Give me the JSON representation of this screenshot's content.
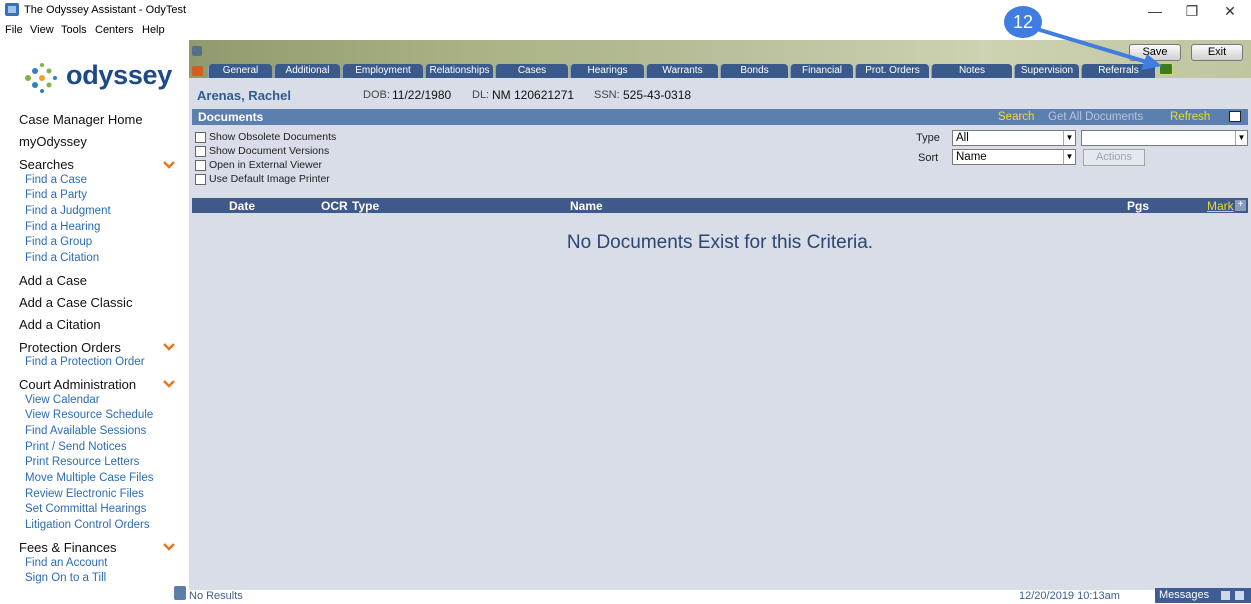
{
  "window": {
    "title": "The Odyssey Assistant - OdyTest",
    "minimize_glyph": "—",
    "restore_glyph": "❐",
    "close_glyph": "✕"
  },
  "menu": [
    "File",
    "View",
    "Tools",
    "Centers",
    "Help"
  ],
  "sidebar": {
    "logo_text": "odyssey",
    "items": [
      {
        "type": "head",
        "label": "Case Manager Home"
      },
      {
        "type": "head",
        "label": "myOdyssey"
      },
      {
        "type": "head",
        "label": "Searches",
        "chevron": true
      },
      {
        "type": "link",
        "label": "Find a Case"
      },
      {
        "type": "link",
        "label": "Find a Party"
      },
      {
        "type": "link",
        "label": "Find a Judgment"
      },
      {
        "type": "link",
        "label": "Find a Hearing"
      },
      {
        "type": "link",
        "label": "Find a Group"
      },
      {
        "type": "link",
        "label": "Find a Citation"
      },
      {
        "type": "head",
        "label": "Add a Case"
      },
      {
        "type": "head",
        "label": "Add a Case Classic"
      },
      {
        "type": "head",
        "label": "Add a Citation"
      },
      {
        "type": "head",
        "label": "Protection Orders",
        "chevron": true
      },
      {
        "type": "link",
        "label": "Find a Protection Order"
      },
      {
        "type": "head",
        "label": "Court Administration",
        "chevron": true
      },
      {
        "type": "link",
        "label": "View Calendar"
      },
      {
        "type": "link",
        "label": "View Resource Schedule"
      },
      {
        "type": "link",
        "label": "Find Available Sessions"
      },
      {
        "type": "link",
        "label": "Print / Send Notices"
      },
      {
        "type": "link",
        "label": "Print Resource Letters"
      },
      {
        "type": "link",
        "label": "Move Multiple Case Files"
      },
      {
        "type": "link",
        "label": "Review Electronic Files"
      },
      {
        "type": "link",
        "label": "Set Committal Hearings"
      },
      {
        "type": "link",
        "label": "Litigation Control Orders"
      },
      {
        "type": "head",
        "label": "Fees & Finances",
        "chevron": true
      },
      {
        "type": "link",
        "label": "Find an Account"
      },
      {
        "type": "link",
        "label": "Sign On to a Till"
      }
    ]
  },
  "banner": {
    "save_label": "Save",
    "exit_label": "Exit"
  },
  "tabs": [
    "General",
    "Additional",
    "Employment",
    "Relationships",
    "Cases",
    "Hearings",
    "Warrants",
    "Bonds",
    "Financial",
    "Prot. Orders",
    "Notes",
    "Supervision",
    "Referrals"
  ],
  "party": {
    "name": "Arenas, Rachel",
    "dob_label": "DOB:",
    "dob": "11/22/1980",
    "dl_label": "DL:",
    "dl": "NM 120621271",
    "ssn_label": "SSN:",
    "ssn": "525-43-0318"
  },
  "documents": {
    "title": "Documents",
    "search_link": "Search",
    "get_all_link": "Get All Documents",
    "refresh_link": "Refresh",
    "options": [
      "Show Obsolete Documents",
      "Show Document Versions",
      "Open in External Viewer",
      "Use Default Image Printer"
    ],
    "type_label": "Type",
    "type_value": "All",
    "sort_label": "Sort",
    "sort_value": "Name",
    "secondary_value": "",
    "actions_label": "Actions",
    "columns": {
      "date": "Date",
      "ocr": "OCR",
      "type": "Type",
      "name": "Name",
      "pgs": "Pgs",
      "mark": "Mark"
    },
    "empty_message": "No Documents Exist for this Criteria."
  },
  "status": {
    "left": "No Results",
    "datetime": "12/20/2019 10:13am",
    "messages_label": "Messages"
  },
  "callout": {
    "number": "12"
  },
  "colors": {
    "accent": "#3f5a8a",
    "link": "#2d6bb5",
    "callout": "#3f7de0",
    "highlight": "#e8d83a"
  }
}
